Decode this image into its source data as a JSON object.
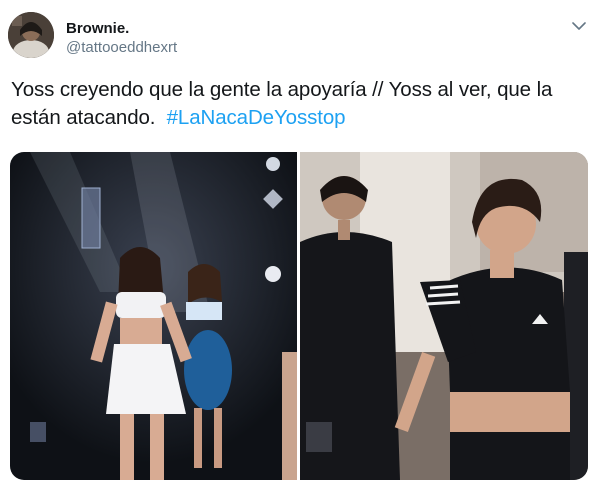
{
  "tweet": {
    "author_name": "Brownie.",
    "author_handle": "@tattooeddhexrt",
    "text_main": "Yoss creyendo que la gente la apoyaría // Yoss al ver, que la están atacando.",
    "hashtag": "#LaNacaDeYosstop"
  },
  "icons": {
    "menu": "chevron-down-icon"
  },
  "colors": {
    "text": "#14171a",
    "secondary": "#657786",
    "link": "#1da1f2"
  }
}
